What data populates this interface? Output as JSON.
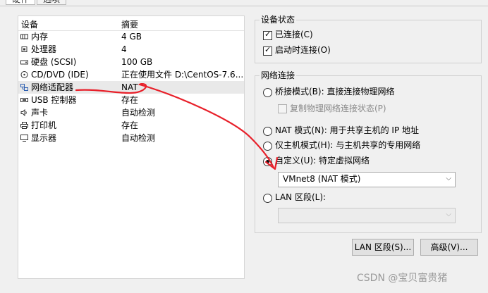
{
  "tabs": [
    {
      "label": "硬件"
    },
    {
      "label": "选项"
    }
  ],
  "device_list": {
    "headers": {
      "device": "设备",
      "summary": "摘要"
    },
    "rows": [
      {
        "name": "内存",
        "summary": "4 GB",
        "icon": "memory-icon"
      },
      {
        "name": "处理器",
        "summary": "4",
        "icon": "cpu-icon"
      },
      {
        "name": "硬盘 (SCSI)",
        "summary": "100 GB",
        "icon": "hard-disk-icon"
      },
      {
        "name": "CD/DVD (IDE)",
        "summary": "正在使用文件 D:\\CentOS-7.6...",
        "icon": "cd-dvd-icon"
      },
      {
        "name": "网络适配器",
        "summary": "NAT",
        "icon": "network-adapter-icon",
        "selected": true
      },
      {
        "name": "USB 控制器",
        "summary": "存在",
        "icon": "usb-icon"
      },
      {
        "name": "声卡",
        "summary": "自动检测",
        "icon": "sound-card-icon"
      },
      {
        "name": "打印机",
        "summary": "存在",
        "icon": "printer-icon"
      },
      {
        "name": "显示器",
        "summary": "自动检测",
        "icon": "display-icon"
      }
    ]
  },
  "device_status": {
    "title": "设备状态",
    "connected": {
      "label": "已连接(C)",
      "checked": true
    },
    "connect_at_power_on": {
      "label": "启动时连接(O)",
      "checked": true
    }
  },
  "network_connection": {
    "title": "网络连接",
    "bridged": {
      "label": "桥接模式(B): 直接连接物理网络",
      "selected": false
    },
    "replicate": {
      "label": "复制物理网络连接状态(P)",
      "checked": false,
      "enabled": false
    },
    "nat": {
      "label": "NAT 模式(N): 用于共享主机的 IP 地址",
      "selected": false
    },
    "host_only": {
      "label": "仅主机模式(H): 与主机共享的专用网络",
      "selected": false
    },
    "custom": {
      "label": "自定义(U): 特定虚拟网络",
      "selected": true
    },
    "custom_select": {
      "value": "VMnet8 (NAT 模式)"
    },
    "lan_segment": {
      "label": "LAN 区段(L):",
      "selected": false
    },
    "lan_select": {
      "value": ""
    }
  },
  "buttons": {
    "lan_segments": "LAN 区段(S)...",
    "advanced": "高级(V)..."
  },
  "watermark": "CSDN @宝贝富贵猪",
  "colors": {
    "annotation_red": "#e8202a",
    "selected_row": "#e9e9e9"
  }
}
